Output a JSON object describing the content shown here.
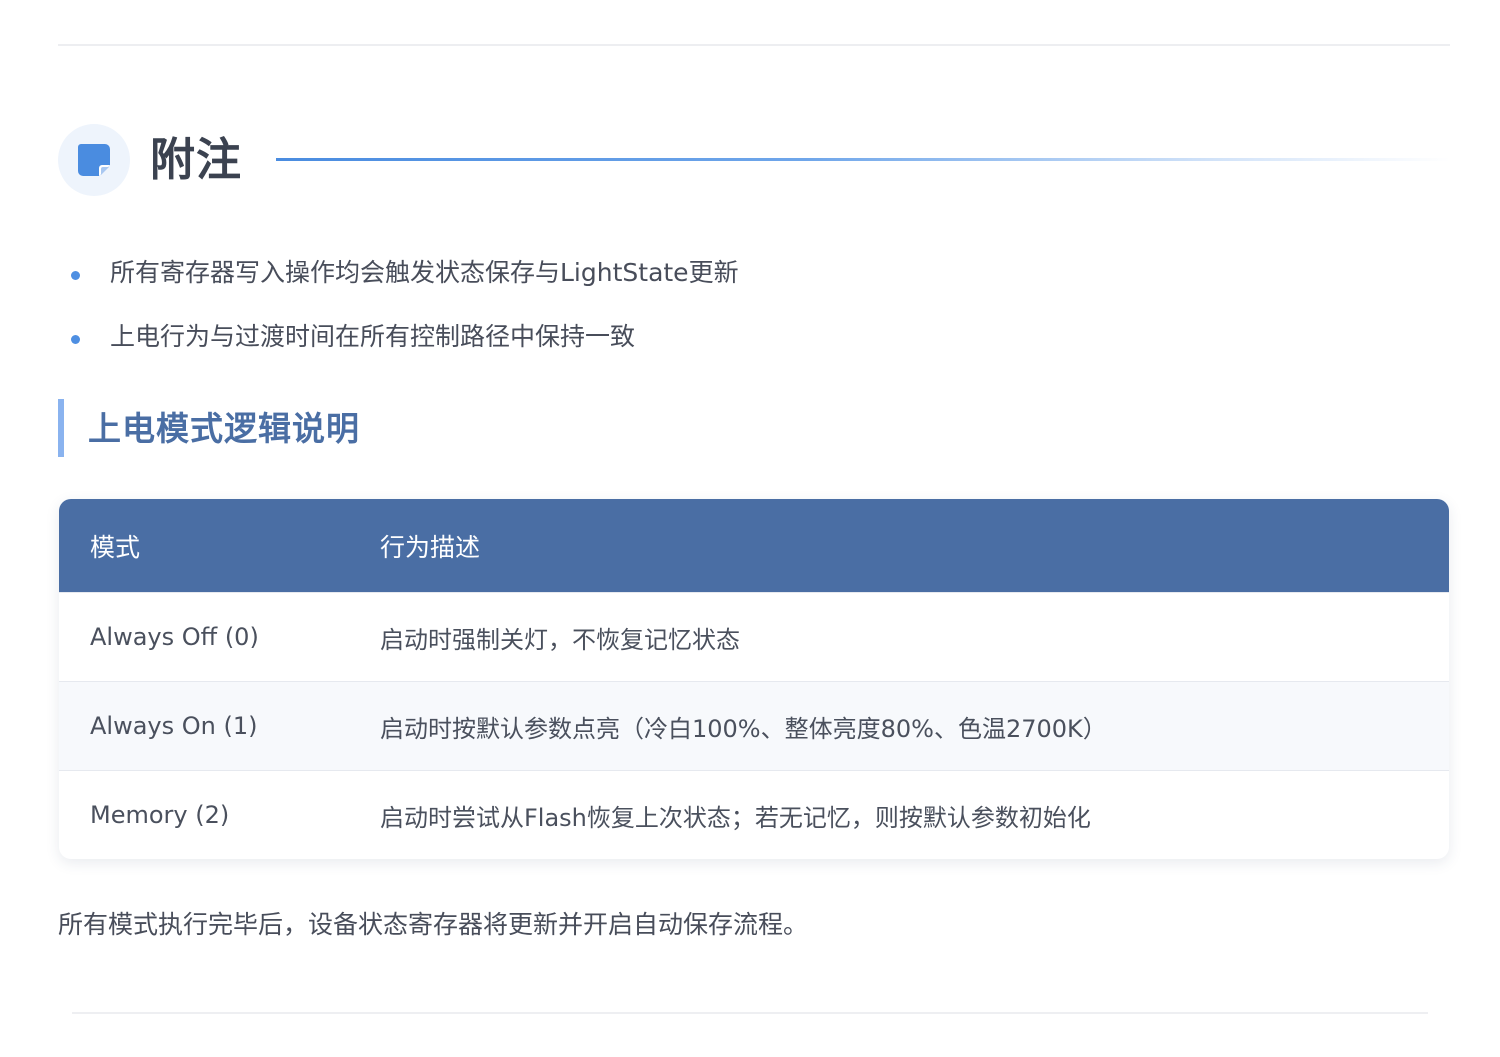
{
  "header": {
    "title": "附注",
    "icon": "note-icon",
    "accent_color": "#4a8ce0"
  },
  "notes": [
    "所有寄存器写入操作均会触发状态保存与LightState更新",
    "上电行为与过渡时间在所有控制路径中保持一致"
  ],
  "sub_heading": "上电模式逻辑说明",
  "table": {
    "header_color": "#4a6ea4",
    "columns": [
      "模式",
      "行为描述"
    ],
    "rows": [
      [
        "Always Off (0)",
        "启动时强制关灯，不恢复记忆状态"
      ],
      [
        "Always On (1)",
        "启动时按默认参数点亮（冷白100%、整体亮度80%、色温2700K）"
      ],
      [
        "Memory (2)",
        "启动时尝试从Flash恢复上次状态；若无记忆，则按默认参数初始化"
      ]
    ]
  },
  "footer_note": "所有模式执行完毕后，设备状态寄存器将更新并开启自动保存流程。"
}
